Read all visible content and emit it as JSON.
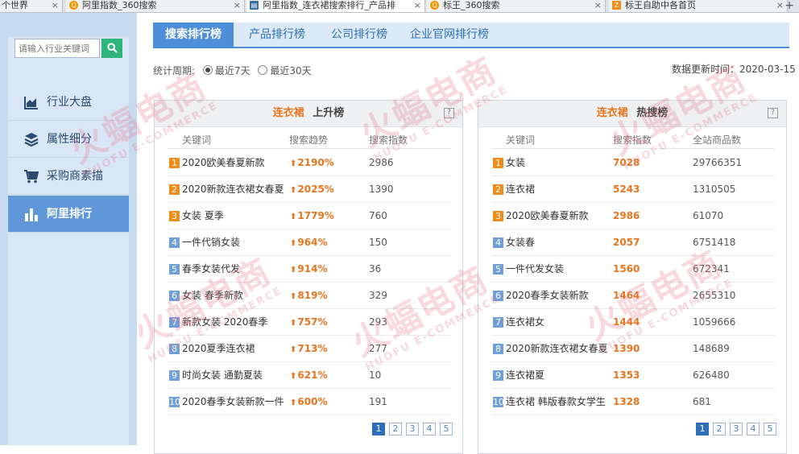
{
  "browser": {
    "tabs": [
      {
        "label": "个世界",
        "active": false
      },
      {
        "label": "阿里指数_360搜索",
        "active": false
      },
      {
        "label": "阿里指数_连衣裙搜索排行_产品排",
        "active": true
      },
      {
        "label": "标王_360搜索",
        "active": false
      },
      {
        "label": "标王自助中各首页",
        "active": false
      }
    ],
    "new_tab": "+"
  },
  "sidebar": {
    "search_placeholder": "请输入行业关键词",
    "items": [
      {
        "label": "行业大盘",
        "icon": "chart-area-icon",
        "active": false
      },
      {
        "label": "属性细分",
        "icon": "layers-icon",
        "active": false
      },
      {
        "label": "采购商素描",
        "icon": "cart-icon",
        "active": false
      },
      {
        "label": "阿里排行",
        "icon": "bar-chart-icon",
        "active": true
      }
    ]
  },
  "topnav": {
    "tabs": [
      {
        "label": "搜索排行榜",
        "active": true
      },
      {
        "label": "产品排行榜",
        "active": false
      },
      {
        "label": "公司排行榜",
        "active": false
      },
      {
        "label": "企业官网排行榜",
        "active": false
      }
    ]
  },
  "filters": {
    "period_label": "统计周期:",
    "options": [
      {
        "label": "最近7天",
        "selected": true
      },
      {
        "label": "最近30天",
        "selected": false
      }
    ]
  },
  "updated": "数据更新时间：2020-03-15",
  "rising": {
    "keyword": "连衣裙",
    "title": "上升榜",
    "columns": [
      "关键词",
      "搜索趋势",
      "搜索指数"
    ],
    "rows": [
      {
        "rank": "1",
        "keyword": "2020欧美春夏新款",
        "trend": "2190%",
        "index": "2986"
      },
      {
        "rank": "2",
        "keyword": "2020新款连衣裙女春夏",
        "trend": "2025%",
        "index": "1390"
      },
      {
        "rank": "3",
        "keyword": "女装 夏季",
        "trend": "1779%",
        "index": "760"
      },
      {
        "rank": "4",
        "keyword": "一件代销女装",
        "trend": "964%",
        "index": "150"
      },
      {
        "rank": "5",
        "keyword": "春季女装代发",
        "trend": "914%",
        "index": "36"
      },
      {
        "rank": "6",
        "keyword": "女装 春季新款",
        "trend": "819%",
        "index": "329"
      },
      {
        "rank": "7",
        "keyword": "新款女装 2020春季",
        "trend": "757%",
        "index": "293"
      },
      {
        "rank": "8",
        "keyword": "2020夏季连衣裙",
        "trend": "713%",
        "index": "277"
      },
      {
        "rank": "9",
        "keyword": "时尚女装 通勤夏装",
        "trend": "621%",
        "index": "10"
      },
      {
        "rank": "10",
        "keyword": "2020春季女装新款一件",
        "trend": "600%",
        "index": "191"
      }
    ],
    "pages": [
      "1",
      "2",
      "3",
      "4",
      "5"
    ]
  },
  "hot": {
    "keyword": "连衣裙",
    "title": "热搜榜",
    "columns": [
      "关键词",
      "搜索指数",
      "全站商品数"
    ],
    "rows": [
      {
        "rank": "1",
        "keyword": "女装",
        "index": "7028",
        "products": "29766351"
      },
      {
        "rank": "2",
        "keyword": "连衣裙",
        "index": "5243",
        "products": "1310505"
      },
      {
        "rank": "3",
        "keyword": "2020欧美春夏新款",
        "index": "2986",
        "products": "61070"
      },
      {
        "rank": "4",
        "keyword": "女装春",
        "index": "2057",
        "products": "6751418"
      },
      {
        "rank": "5",
        "keyword": "一件代发女装",
        "index": "1560",
        "products": "672341"
      },
      {
        "rank": "6",
        "keyword": "2020春季女装新款",
        "index": "1464",
        "products": "2655310"
      },
      {
        "rank": "7",
        "keyword": "连衣裙女",
        "index": "1444",
        "products": "1059666"
      },
      {
        "rank": "8",
        "keyword": "2020新款连衣裙女春夏",
        "index": "1390",
        "products": "148689"
      },
      {
        "rank": "9",
        "keyword": "连衣裙夏",
        "index": "1353",
        "products": "626480"
      },
      {
        "rank": "10",
        "keyword": "连衣裙 韩版春款女学生",
        "index": "1328",
        "products": "681"
      }
    ],
    "pages": [
      "1",
      "2",
      "3",
      "4",
      "5"
    ]
  },
  "watermark": {
    "brand": "火蝠电商",
    "sub": "HUOFU E-COMMERCE"
  },
  "colors": {
    "accent": "#4f8fd9",
    "orange": "#e8741d",
    "sidebar_active": "#5f97d8"
  }
}
